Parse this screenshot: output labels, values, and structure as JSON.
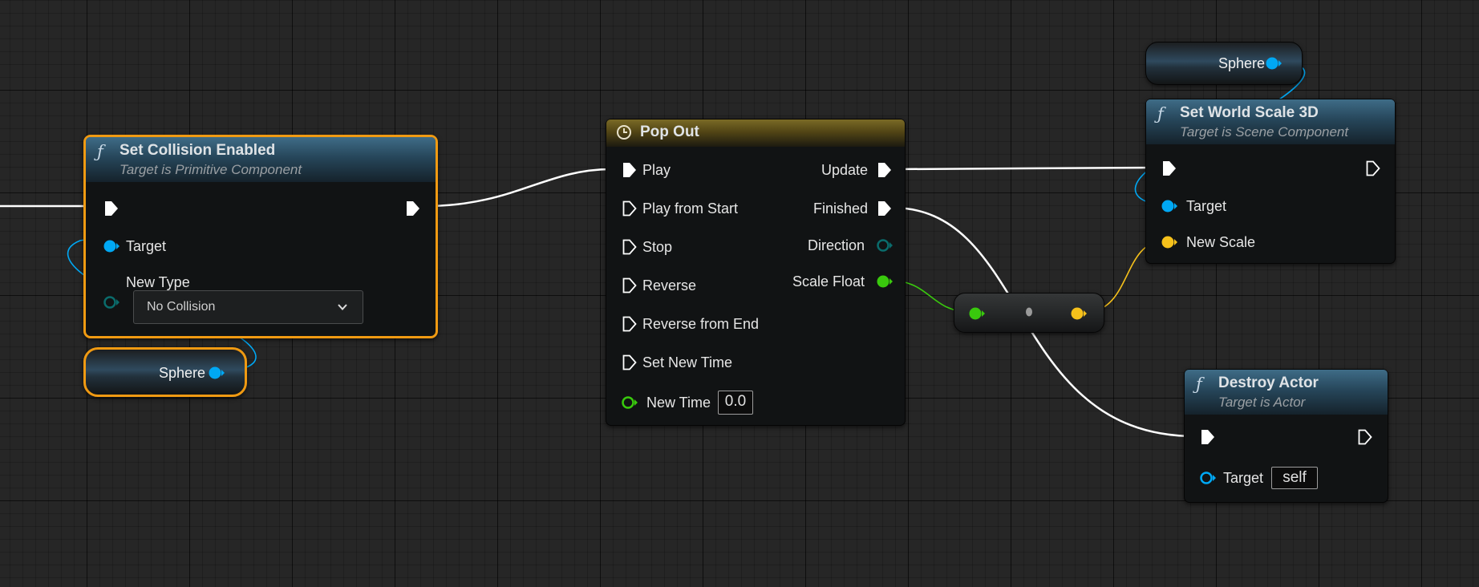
{
  "nodes": {
    "set_collision": {
      "title": "Set Collision Enabled",
      "subtitle": "Target is Primitive Component",
      "target_label": "Target",
      "new_type_label": "New Type",
      "new_type_value": "No Collision",
      "selected": true
    },
    "sphere_left": {
      "label": "Sphere",
      "selected": true
    },
    "pop_out": {
      "title": "Pop Out",
      "inputs": [
        "Play",
        "Play from Start",
        "Stop",
        "Reverse",
        "Reverse from End",
        "Set New Time"
      ],
      "new_time_label": "New Time",
      "new_time_value": "0.0",
      "outputs": [
        "Update",
        "Finished",
        "Direction",
        "Scale Float"
      ]
    },
    "sphere_top": {
      "label": "Sphere"
    },
    "set_world_scale": {
      "title": "Set World Scale 3D",
      "subtitle": "Target is Scene Component",
      "target_label": "Target",
      "new_scale_label": "New Scale"
    },
    "destroy_actor": {
      "title": "Destroy Actor",
      "subtitle": "Target is Actor",
      "target_label": "Target",
      "target_value": "self"
    }
  },
  "icons": {
    "function": "f",
    "timeline": "clock-icon",
    "exec": "exec-arrow-icon",
    "object_pin": "blue-circle-pin-icon",
    "float_pin": "green-circle-pin-icon",
    "vector_pin": "yellow-circle-pin-icon",
    "dropdown": "chevron-down-icon"
  },
  "colors": {
    "background": "#262626",
    "selection": "#f09a12",
    "function_header": "#3f6c87",
    "timeline_header": "#7a6a26",
    "exec_wire": "#ffffff",
    "object_pin": "#00a8f4",
    "float_pin": "#39c90d",
    "vector_pin": "#f6c11b",
    "enum_pin": "#0a6b6b"
  }
}
